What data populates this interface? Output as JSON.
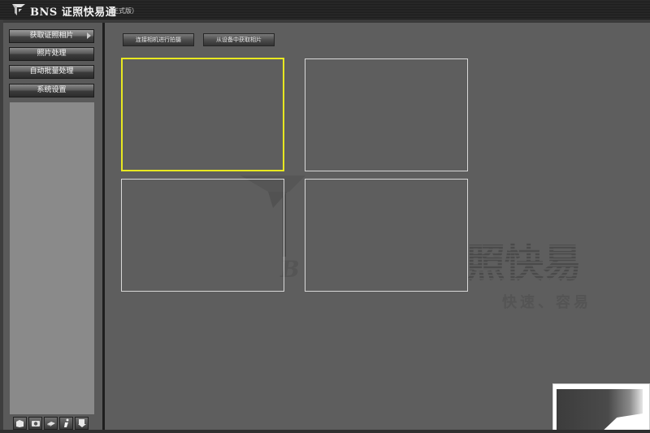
{
  "app": {
    "title": "BNS 证照快易通",
    "edition": "（正式版）"
  },
  "sidebar": {
    "items": [
      {
        "label": "获取证照相片",
        "active": true
      },
      {
        "label": "照片处理",
        "active": false
      },
      {
        "label": "自动批量处理",
        "active": false
      },
      {
        "label": "系统设置",
        "active": false
      }
    ],
    "toolbar_icons": [
      "open-icon",
      "camera-icon",
      "scanner-icon",
      "info-icon",
      "export-icon"
    ]
  },
  "main": {
    "buttons": {
      "connect_camera": "连接相机进行拍摄",
      "from_device": "从设备中获取相片"
    }
  },
  "watermark": {
    "letter": "B",
    "title": "照快易",
    "subtitle": "快速、容易"
  },
  "colors": {
    "background": "#5e5e5e",
    "selected_border": "#e8e820",
    "slot_border": "#d8d8d8"
  }
}
